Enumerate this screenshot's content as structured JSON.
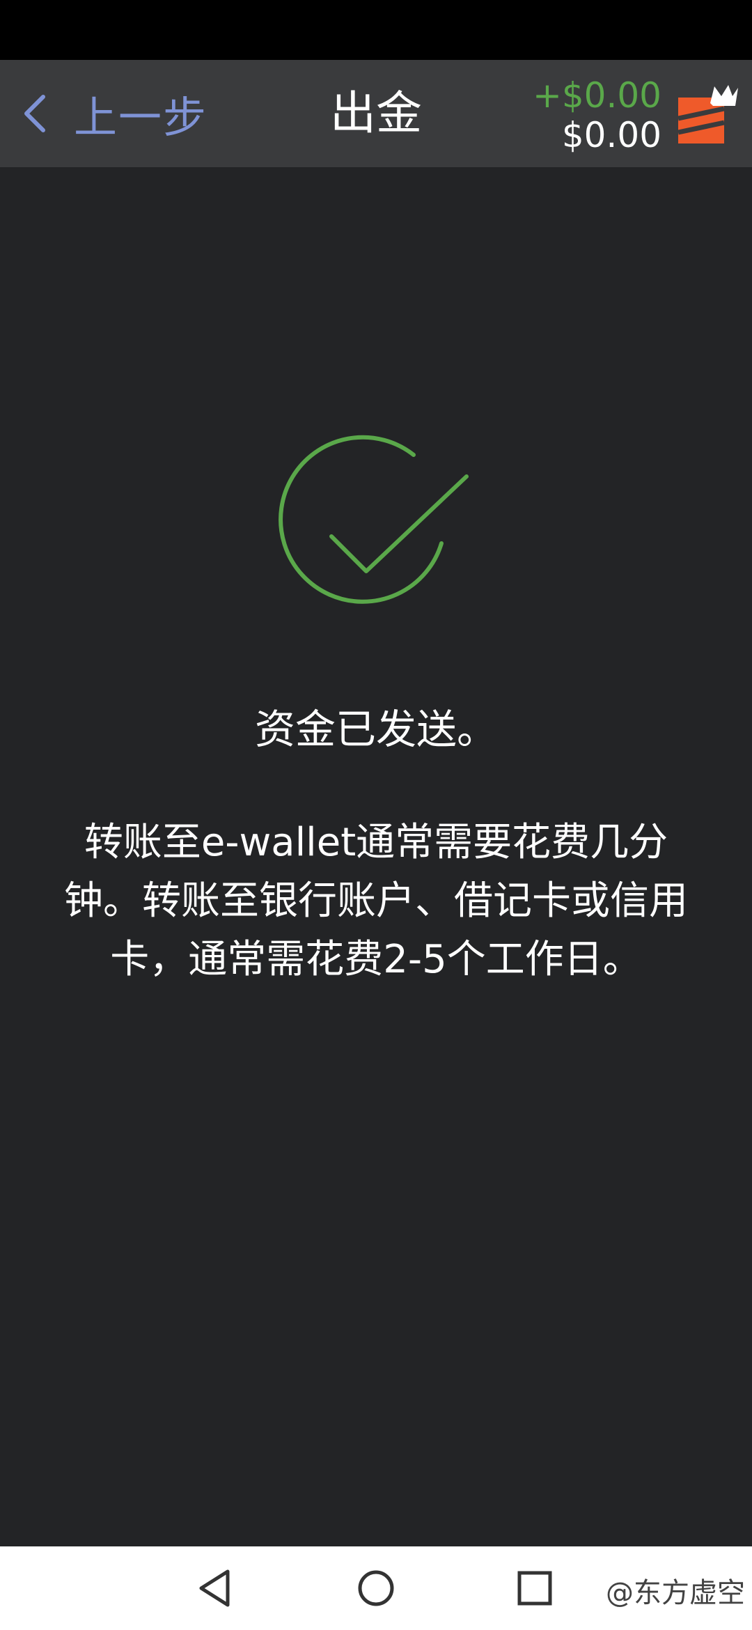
{
  "header": {
    "back_label": "上一步",
    "title": "出金",
    "balance_change": "+$0.00",
    "balance_total": "$0.00"
  },
  "main": {
    "success_title": "资金已发送。",
    "message_lines": [
      "转账至e-wallet通常需要花费几分",
      "钟。转账至银行账户、借记卡或信用",
      "卡，通常需花费2-5个工作日。"
    ]
  },
  "watermark": "@东方虚空",
  "icons": {
    "back": "chevron-left-icon",
    "logo": "brand-logo-icon",
    "success": "check-circle-icon",
    "nav_back": "triangle-back-icon",
    "nav_home": "circle-home-icon",
    "nav_recent": "square-recent-icon"
  },
  "colors": {
    "background": "#232426",
    "header": "#3a3b3d",
    "accent_blue": "#7f93d6",
    "success_green": "#5aa84a",
    "logo_orange": "#ef5a2a"
  }
}
